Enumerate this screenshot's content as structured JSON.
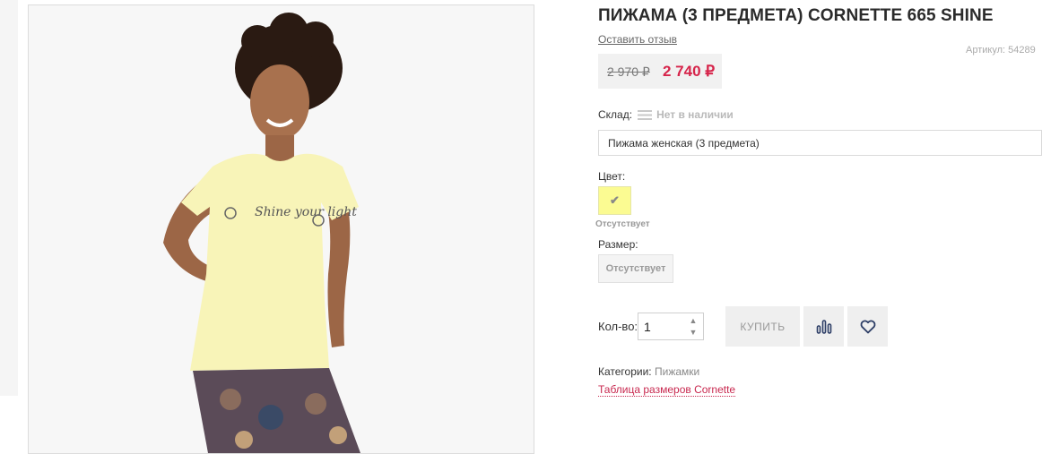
{
  "product": {
    "title": "ПИЖАМА (3 ПРЕДМЕТА) CORNETTE 665 SHINE",
    "review_link": "Оставить отзыв",
    "sku": "Артикул: 54289",
    "old_price": "2 970 ₽",
    "new_price": "2 740 ₽",
    "image_alt_colors": {
      "shirt": "#f8f4b8",
      "background": "#f8f8f8"
    }
  },
  "stock": {
    "label": "Склад:",
    "status": "Нет в наличии"
  },
  "variant": {
    "selected": "Пижама женская (3 предмета)"
  },
  "color": {
    "label": "Цвет:",
    "swatch_color": "#fbfb92",
    "note": "Отсутствует"
  },
  "size": {
    "label": "Размер:",
    "option": "Отсутствует"
  },
  "quantity": {
    "label": "Кол-во:",
    "value": "1"
  },
  "actions": {
    "buy_label": "КУПИТЬ",
    "compare_icon": "bar-chart-icon",
    "wishlist_icon": "heart-icon"
  },
  "meta": {
    "categories_label": "Категории:",
    "category": "Пижамки",
    "size_table_link": "Таблица размеров Cornette"
  },
  "colors": {
    "accent": "#d6244a",
    "link": "#c8284f"
  }
}
